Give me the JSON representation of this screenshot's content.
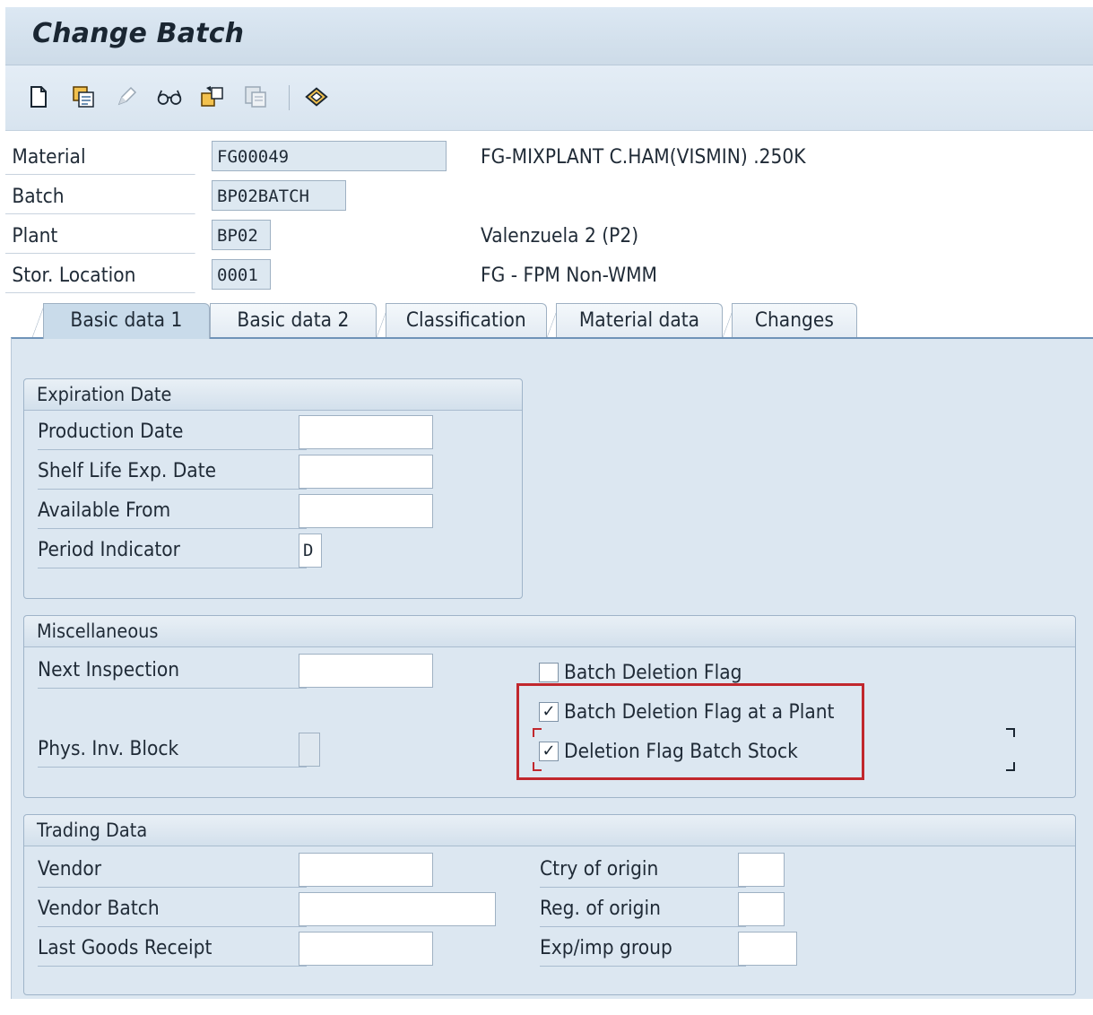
{
  "window": {
    "title": "Change Batch"
  },
  "toolbar": {
    "icons": [
      "new-document-icon",
      "copy-icon",
      "edit-pencil-icon",
      "display-glasses-icon",
      "export-icon",
      "disabled-save-icon",
      "classification-icon"
    ]
  },
  "header": {
    "material_label": "Material",
    "material_value": "FG00049",
    "material_desc": "FG-MIXPLANT C.HAM(VISMIN) .250K",
    "batch_label": "Batch",
    "batch_value": "BP02BATCH",
    "plant_label": "Plant",
    "plant_value": "BP02",
    "plant_desc": "Valenzuela 2  (P2)",
    "stor_label": "Stor. Location",
    "stor_value": "0001",
    "stor_desc": "FG - FPM Non-WMM"
  },
  "tabs": [
    {
      "label": "Basic data 1",
      "active": true
    },
    {
      "label": "Basic data 2",
      "active": false
    },
    {
      "label": "Classification",
      "active": false
    },
    {
      "label": "Material data",
      "active": false
    },
    {
      "label": "Changes",
      "active": false
    }
  ],
  "expiration": {
    "title": "Expiration Date",
    "production_date_label": "Production Date",
    "production_date_value": "",
    "shelf_life_label": "Shelf Life Exp. Date",
    "shelf_life_value": "",
    "available_from_label": "Available From",
    "available_from_value": "",
    "period_indicator_label": "Period Indicator",
    "period_indicator_value": "D"
  },
  "misc": {
    "title": "Miscellaneous",
    "next_inspection_label": "Next Inspection",
    "next_inspection_value": "",
    "phys_inv_label": "Phys. Inv. Block",
    "batch_deletion_flag_label": "Batch Deletion Flag",
    "batch_deletion_flag_checked": false,
    "batch_deletion_plant_label": "Batch Deletion Flag at a Plant",
    "batch_deletion_plant_checked": true,
    "deletion_flag_stock_label": "Deletion Flag Batch Stock",
    "deletion_flag_stock_checked": true,
    "check_mark": "✓"
  },
  "trading": {
    "title": "Trading Data",
    "vendor_label": "Vendor",
    "vendor_value": "",
    "vendor_batch_label": "Vendor Batch",
    "vendor_batch_value": "",
    "last_gr_label": "Last Goods Receipt",
    "last_gr_value": "",
    "ctry_origin_label": "Ctry of origin",
    "ctry_origin_value": "",
    "reg_origin_label": "Reg. of origin",
    "reg_origin_value": "",
    "exp_imp_label": "Exp/imp group",
    "exp_imp_value": ""
  },
  "colors": {
    "highlight_box": "#c1272d",
    "panel_bg": "#dce7f1",
    "active_tab": "#c9dbea"
  }
}
